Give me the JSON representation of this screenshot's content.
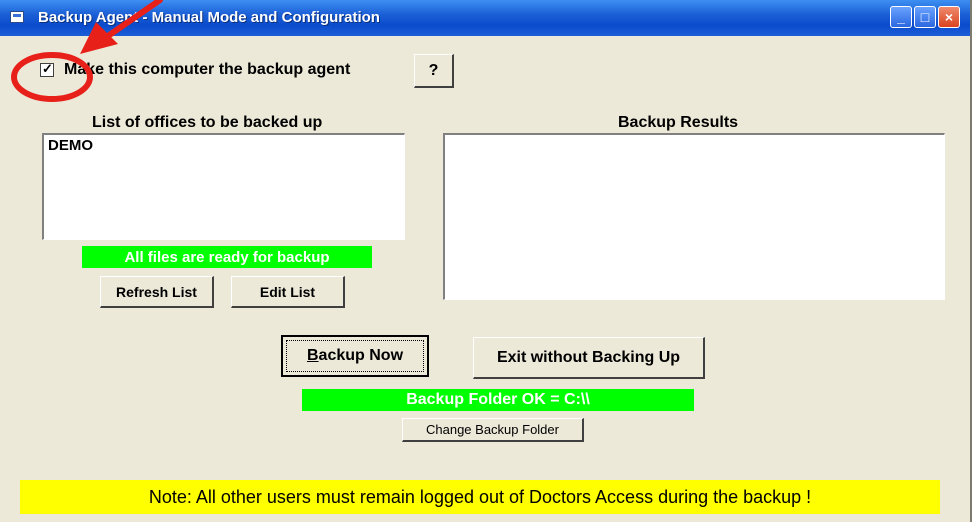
{
  "window": {
    "title": "Backup Agent - Manual Mode and Configuration",
    "minimize_icon": "minimize-icon",
    "maximize_icon": "maximize-icon",
    "close_icon": "close-icon"
  },
  "agent": {
    "checkbox_checked": true,
    "checkbox_label": "Make this computer the backup agent",
    "help_label": "?"
  },
  "offices": {
    "heading": "List of offices to be backed up",
    "items": [
      "DEMO"
    ],
    "status": "All files are ready for backup",
    "refresh_label": "Refresh List",
    "edit_label": "Edit List"
  },
  "results": {
    "heading": "Backup Results"
  },
  "actions": {
    "backup_now": "Backup Now",
    "exit_label": "Exit without Backing Up"
  },
  "folder": {
    "status": "Backup Folder OK = C:\\\\",
    "change_label": "Change Backup Folder"
  },
  "note": "Note: All other users must remain logged out of Doctors Access during the backup !",
  "colors": {
    "status_green": "#00ff00",
    "note_yellow": "#ffff00",
    "annotation_red": "#e8201a",
    "titlebar_blue": "#0a4bcc"
  }
}
